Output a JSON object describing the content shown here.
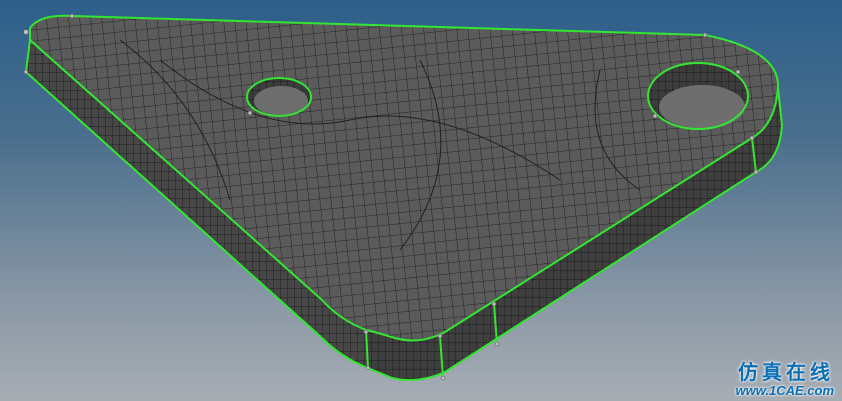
{
  "viewport": {
    "background_top": "#2c5f8b",
    "background_bottom": "#a7adb3"
  },
  "model": {
    "part": "triangular-bracket-plate",
    "hole_count": 2,
    "face_color": "#5b5b5b",
    "side_color": "#474747",
    "mesh_line_color": "#111111",
    "feature_edge_color": "#32e632",
    "node_marker_color": "#bdbdbd"
  },
  "watermark": {
    "brand_cn": "仿真在线",
    "url": "www.1CAE.com",
    "color": "#0b6fb6"
  }
}
